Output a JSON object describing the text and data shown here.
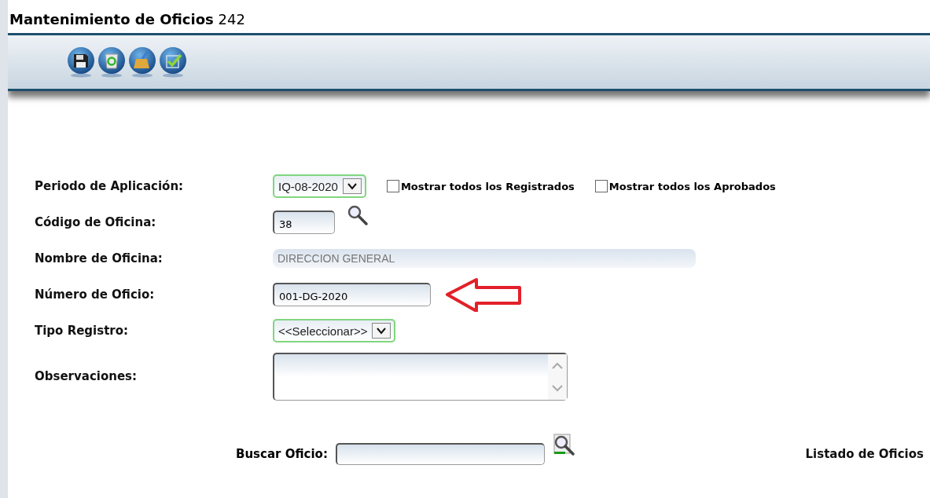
{
  "window": {
    "title": "**Mantenimiento de Oficios** 242"
  },
  "filters": [
    {
      "label": "Mostrar todos los Registrados",
      "checked": false
    },
    {
      "label": "Mostrar todos los Aprobados",
      "checked": false
    }
  ],
  "form": [
    {
      "label": "Periodo de Aplicación:",
      "kind": "select",
      "value": "IQ-08-2020"
    },
    {
      "label": "Código de Oficina:",
      "kind": "lookup",
      "value": "38"
    },
    {
      "label": "Nombre de Oficina:",
      "kind": "readonly",
      "value": "DIRECCION GENERAL"
    },
    {
      "label": "Número de Oficio:",
      "kind": "input",
      "value": "001-DG-2020"
    },
    {
      "label": "Tipo Registro:",
      "kind": "select",
      "value": "<<Seleccionar>>"
    },
    {
      "label": "Observaciones:",
      "kind": "textarea"
    }
  ],
  "search": {
    "label": "Buscar Oficio:",
    "link": "Listado de Oficios"
  }
}
